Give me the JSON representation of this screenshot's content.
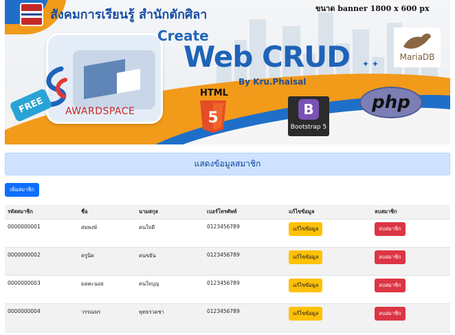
{
  "banner": {
    "org_name": "สังคมการเรียนรู้ สำนักตักศิลา",
    "size_note": "ขนาด banner 1800 x 600 px",
    "create": "Create",
    "title": "Web CRUD",
    "byline": "By Kru.Phaisal",
    "awardspace": "AWARDSPACE",
    "free": "FREE",
    "html_label": "HTML",
    "bootstrap_label": "Bootstrap 5",
    "php_label": "php",
    "mariadb_label": "MariaDB"
  },
  "page": {
    "title": "แสดงข้อมูลสมาชิก",
    "add_button": "เพิ่มสมาชิก"
  },
  "table": {
    "headers": [
      "รหัสสมาชิก",
      "ชื่อ",
      "นามสกุล",
      "เบอร์โทรศัพท์",
      "แก้ไขข้อมูล",
      "ลบสมาชิก"
    ],
    "rows": [
      {
        "id": "0000000001",
        "first": "สมพงษ์",
        "last": "คนใจดี",
        "phone": "0123456789"
      },
      {
        "id": "0000000002",
        "first": "ครูนิด",
        "last": "คนขยัน",
        "phone": "0123456789"
      },
      {
        "id": "0000000003",
        "first": "มดตะนอย",
        "last": "คนใจบุญ",
        "phone": "0123456789"
      },
      {
        "id": "0000000004",
        "first": "วรรณพร",
        "last": "พุทธรวดชา",
        "phone": "0123456789"
      }
    ],
    "edit_label": "แก้ไขข้อมูล",
    "delete_label": "ลบสมาชิก"
  },
  "colors": {
    "primary": "#0d6efd",
    "warning": "#ffc107",
    "danger": "#dc3545",
    "title_bg": "#cfe2ff",
    "title_text": "#084298"
  }
}
